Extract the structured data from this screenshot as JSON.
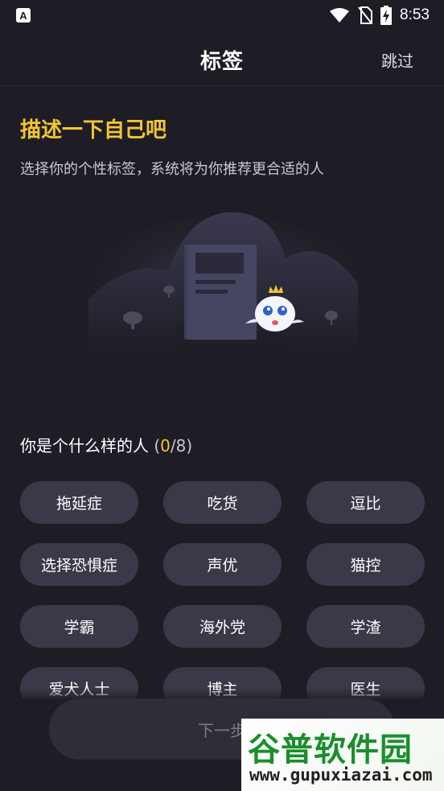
{
  "status_bar": {
    "app_icon_letter": "A",
    "time": "8:53",
    "icons": [
      "wifi-icon",
      "no-sim-icon",
      "battery-charging-icon"
    ]
  },
  "header": {
    "title": "标签",
    "skip_label": "跳过"
  },
  "intro": {
    "heading": "描述一下自己吧",
    "subtitle": "选择你的个性标签，系统将为你推荐更合适的人"
  },
  "question": {
    "label": "你是个什么样的人",
    "open": "(",
    "selected": "0",
    "total": "/8)"
  },
  "tags": [
    {
      "label": "拖延症"
    },
    {
      "label": "吃货"
    },
    {
      "label": "逗比"
    },
    {
      "label": "选择恐惧症"
    },
    {
      "label": "声优"
    },
    {
      "label": "猫控"
    },
    {
      "label": "学霸"
    },
    {
      "label": "海外党"
    },
    {
      "label": "学渣"
    },
    {
      "label": "爱犬人士"
    },
    {
      "label": "博主"
    },
    {
      "label": "医生"
    }
  ],
  "next_button": {
    "label": "下一步"
  },
  "watermark": {
    "main": "谷普软件园",
    "url": "www.gupuxiazai.com"
  },
  "colors": {
    "background": "#1e1d25",
    "accent": "#f3c630",
    "tag_background": "#3a3947"
  }
}
